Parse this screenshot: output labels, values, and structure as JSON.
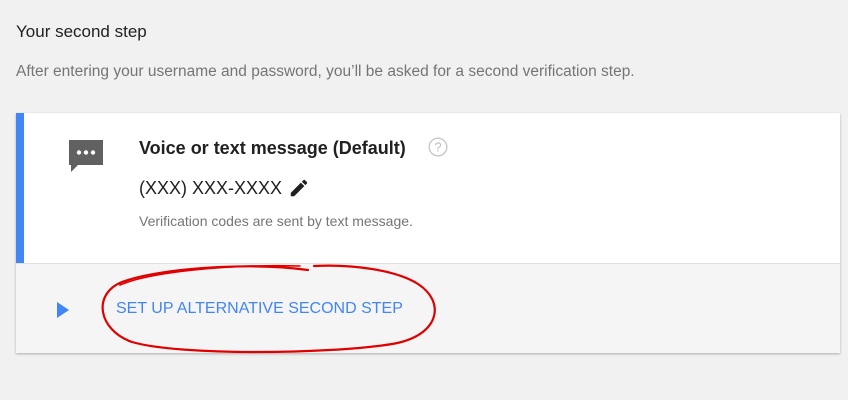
{
  "section": {
    "title": "Your second step",
    "description": "After entering your username and password, you’ll be asked for a second verification step."
  },
  "method": {
    "title": "Voice or text message (Default)",
    "icon": "sms-icon",
    "help_icon": "help-icon",
    "phone": "(XXX) XXX-XXXX",
    "edit_icon": "pencil-icon",
    "note": "Verification codes are sent by text message."
  },
  "alternative": {
    "expand_icon": "play-arrow-icon",
    "label": "SET UP ALTERNATIVE SECOND STEP"
  },
  "colors": {
    "accent": "#4285f4",
    "annotation": "#e00000"
  }
}
